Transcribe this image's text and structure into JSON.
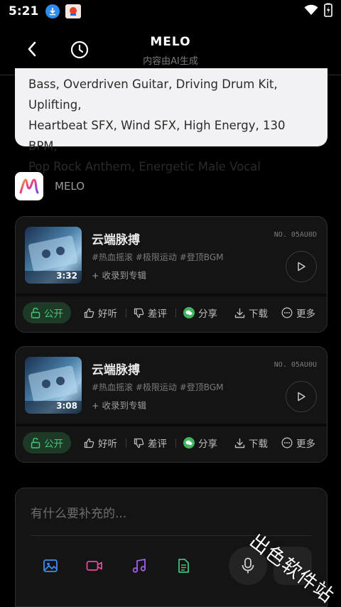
{
  "status_bar": {
    "time": "5:21"
  },
  "header": {
    "title": "MELO",
    "subtitle": "内容由AI生成"
  },
  "prompt": {
    "lines": [
      "Bass, Overdriven Guitar, Driving Drum Kit, Uplifting,",
      "Heartbeat SFX, Wind SFX, High Energy, 130 BPM,",
      "Pop Rock Anthem, Energetic Male Vocal"
    ]
  },
  "assistant": {
    "name": "MELO"
  },
  "songs": [
    {
      "title": "云端脉搏",
      "duration": "3:32",
      "number": "NO. 05AU0D",
      "tags": "#热血摇滚  #极限运动  #登顶BGM",
      "album_action": "+ 收录到专辑",
      "actions": {
        "public": "公开",
        "like": "好听",
        "dislike": "差评",
        "share": "分享",
        "download": "下载",
        "more": "更多"
      }
    },
    {
      "title": "云端脉搏",
      "duration": "3:08",
      "number": "NO. 05AU0U",
      "tags": "#热血摇滚  #极限运动  #登顶BGM",
      "album_action": "+ 收录到专辑",
      "actions": {
        "public": "公开",
        "like": "好听",
        "dislike": "差评",
        "share": "分享",
        "download": "下载",
        "more": "更多"
      }
    }
  ],
  "composer": {
    "placeholder": "有什么要补充的...",
    "tools": [
      "image-icon",
      "video-icon",
      "music-icon",
      "document-icon"
    ],
    "colors": {
      "image": "#3f8cf0",
      "video": "#e84a9a",
      "music": "#a35ee8",
      "document": "#3ec27a",
      "public_green": "#4ac27a"
    }
  },
  "watermark": "出色软件站"
}
